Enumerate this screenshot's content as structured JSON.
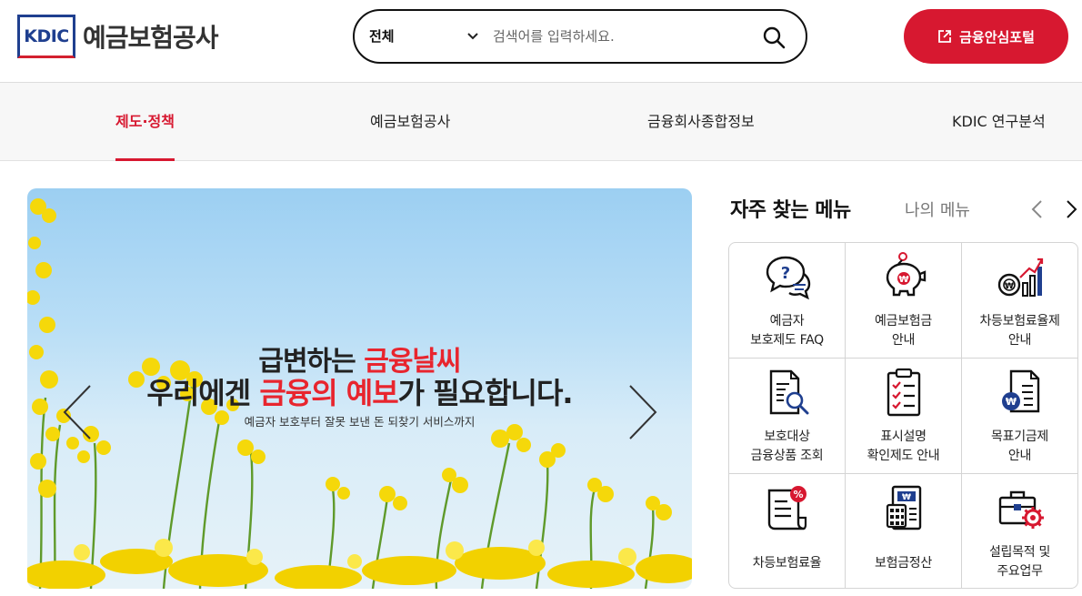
{
  "header": {
    "logo_mark": "KDIC",
    "logo_name": "예금보험공사",
    "search": {
      "scope": "전체",
      "placeholder": "검색어를 입력하세요."
    },
    "portal_button": "금융안심포털"
  },
  "gnb": [
    "제도·정책",
    "예금보험공사",
    "금융회사종합정보",
    "KDIC 연구분석"
  ],
  "banner": {
    "line1_a": "급변하는 ",
    "line1_b": "금융날씨",
    "line2_a": "우리에겐 ",
    "line2_b": "금융의 예보",
    "line2_c": "가 필요합니다.",
    "sub": "예금자 보호부터 잘못 보낸 돈 되찾기 서비스까지"
  },
  "quick_menu": {
    "title": "자주 찾는 메뉴",
    "tab2": "나의 메뉴",
    "items": [
      {
        "l1": "예금자",
        "l2": "보호제도 FAQ",
        "icon": "faq-bubble-icon"
      },
      {
        "l1": "예금보험금",
        "l2": "안내",
        "icon": "piggy-bank-icon"
      },
      {
        "l1": "차등보험료율제",
        "l2": "안내",
        "icon": "coin-growth-chart-icon"
      },
      {
        "l1": "보호대상",
        "l2": "금융상품 조회",
        "icon": "document-search-icon"
      },
      {
        "l1": "표시설명",
        "l2": "확인제도 안내",
        "icon": "checklist-clipboard-icon"
      },
      {
        "l1": "목표기금제",
        "l2": "안내",
        "icon": "won-document-icon"
      },
      {
        "l1": "차등보험료율",
        "l2": "",
        "icon": "percent-document-icon"
      },
      {
        "l1": "보험금정산",
        "l2": "",
        "icon": "calculator-icon"
      },
      {
        "l1": "설립목적 및",
        "l2": "주요업무",
        "icon": "briefcase-gear-icon"
      }
    ]
  },
  "colors": {
    "accent": "#d71830",
    "navy": "#1f3f8f"
  }
}
